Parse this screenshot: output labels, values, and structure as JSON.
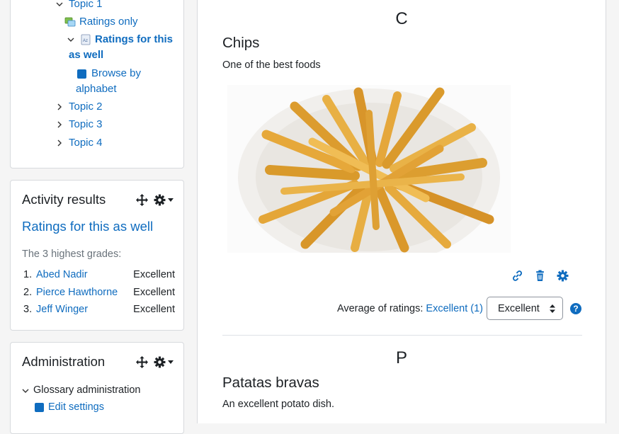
{
  "nav": {
    "topic1": "Topic 1",
    "ratings_only": "Ratings only",
    "ratings_for_this": "Ratings for this",
    "as_well": "as well",
    "browse_by": "Browse by",
    "alphabet": "alphabet",
    "topic2": "Topic 2",
    "topic3": "Topic 3",
    "topic4": "Topic 4"
  },
  "activity_results": {
    "title": "Activity results",
    "activity_link": "Ratings for this as well",
    "highest_label": "The 3 highest grades:",
    "ranks": [
      {
        "num": "1.",
        "name": "Abed Nadir",
        "grade": "Excellent"
      },
      {
        "num": "2.",
        "name": "Pierce Hawthorne",
        "grade": "Excellent"
      },
      {
        "num": "3.",
        "name": "Jeff Winger",
        "grade": "Excellent"
      }
    ]
  },
  "administration": {
    "title": "Administration",
    "glossary_admin": "Glossary administration",
    "edit_settings": "Edit settings"
  },
  "entries": [
    {
      "letter": "C",
      "title": "Chips",
      "description": "One of the best foods",
      "avg_label": "Average of ratings:",
      "avg_value": "Excellent (1)",
      "select_value": "Excellent"
    },
    {
      "letter": "P",
      "title": "Patatas bravas",
      "description": "An excellent potato dish."
    }
  ],
  "colors": {
    "link": "#0f6cbf",
    "help_icon": "#0f6cbf"
  }
}
